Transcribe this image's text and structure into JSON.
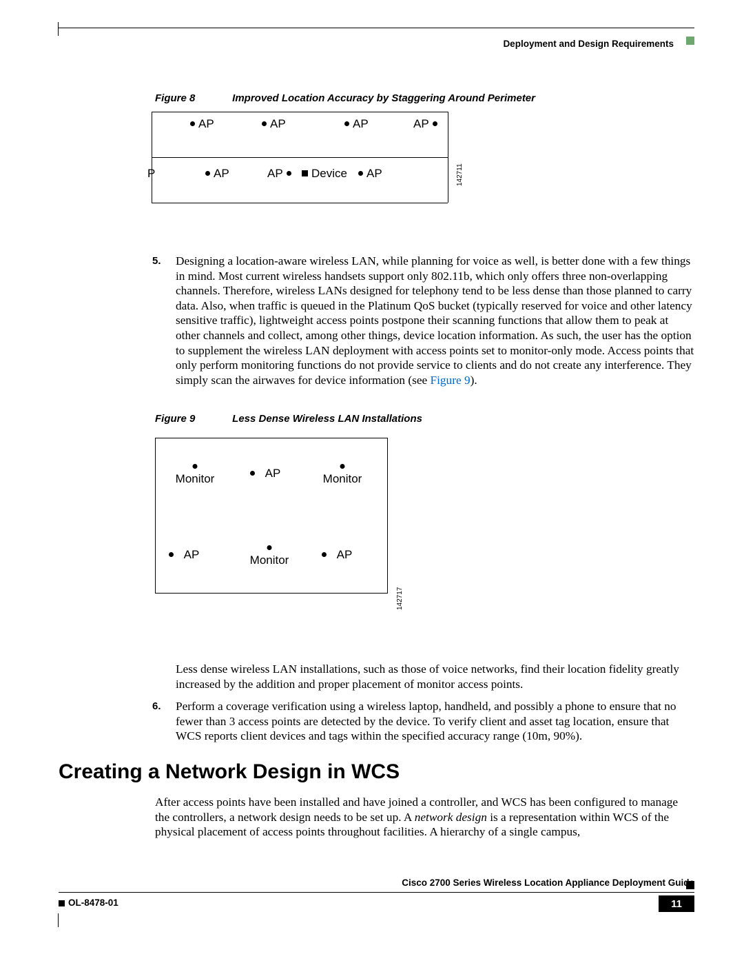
{
  "header": {
    "running": "Deployment and Design Requirements"
  },
  "figure8": {
    "label": "Figure 8",
    "title": "Improved Location Accuracy by Staggering Around Perimeter",
    "ap": "AP",
    "device": "Device",
    "p": "P",
    "id": "142711"
  },
  "step5": {
    "num": "5.",
    "text_a": "Designing a location-aware wireless LAN, while planning for voice as well, is better done with a few things in mind. Most current wireless handsets support only 802.11b, which only offers three non-overlapping channels. Therefore, wireless LANs designed for telephony tend to be less dense than those planned to carry data. Also, when traffic is queued in the Platinum QoS bucket (typically reserved for voice and other latency sensitive traffic), lightweight access points postpone their scanning functions that allow them to peak at other channels and collect, among other things, device location information. As such, the user has the option to supplement the wireless LAN deployment with access points set to monitor-only mode. Access points that only perform monitoring functions do not provide service to clients and do not create any interference. They simply scan the airwaves for device information (see ",
    "link": "Figure 9",
    "text_b": ")."
  },
  "figure9": {
    "label": "Figure 9",
    "title": "Less Dense Wireless LAN Installations",
    "ap": "AP",
    "monitor": "Monitor",
    "id": "142717"
  },
  "after_fig9": {
    "text": "Less dense wireless LAN installations, such as those of voice networks, find their location fidelity greatly increased by the addition and proper placement of monitor access points."
  },
  "step6": {
    "num": "6.",
    "text": "Perform a coverage verification using a wireless laptop, handheld, and possibly a phone to ensure that no fewer than 3 access points are detected by the device. To verify client and asset tag location, ensure that WCS reports client devices and tags within the specified accuracy range (10m, 90%)."
  },
  "heading": "Creating a Network Design in WCS",
  "after_heading": {
    "a": "After access points have been installed and have joined a controller, and WCS has been configured to manage the controllers, a network design needs to be set up. A ",
    "i": "network design",
    "b": " is a representation within WCS of the physical placement of access points throughout facilities. A hierarchy of a single campus,"
  },
  "footer": {
    "title": "Cisco 2700 Series Wireless Location Appliance Deployment Guide",
    "docnum": "OL-8478-01",
    "page": "11"
  }
}
